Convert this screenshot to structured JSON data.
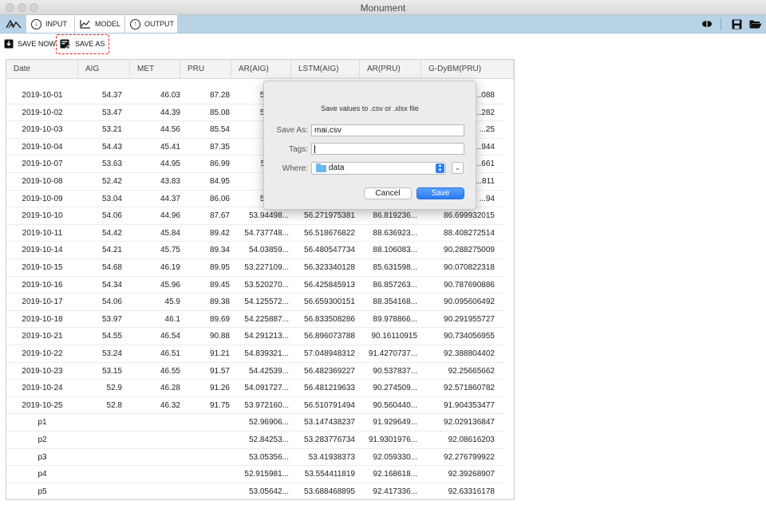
{
  "window": {
    "title": "Monument"
  },
  "tabs": [
    {
      "label": "INPUT",
      "icon": "arrow-down-circle-icon"
    },
    {
      "label": "MODEL",
      "icon": "chart-icon"
    },
    {
      "label": "OUTPUT",
      "icon": "arrow-up-circle-icon"
    }
  ],
  "toolbar": {
    "save_now_label": "SAVE NOW",
    "save_as_label": "SAVE AS"
  },
  "table": {
    "columns": [
      "Date",
      "AIG",
      "MET",
      "PRU",
      "AR(AIG)",
      "LSTM(AIG)",
      "AR(PRU)",
      "G-DyBM(PRU)"
    ],
    "rows": [
      [
        "2019-10-01",
        "54.37",
        "46.03",
        "87.28",
        "57.3886",
        "",
        "",
        "...088"
      ],
      [
        "2019-10-02",
        "53.47",
        "44.39",
        "85.08",
        "57.1207",
        "",
        "",
        "...282"
      ],
      [
        "2019-10-03",
        "53.21",
        "44.56",
        "85.54",
        "56.252",
        "",
        "",
        "...25"
      ],
      [
        "2019-10-04",
        "54.43",
        "45.41",
        "87.35",
        "56.605",
        "",
        "",
        "...944"
      ],
      [
        "2019-10-07",
        "53.63",
        "44.95",
        "86.99",
        "56.1166",
        "",
        "",
        "...661"
      ],
      [
        "2019-10-08",
        "52.42",
        "43.83",
        "84.95",
        "55.070",
        "",
        "",
        "...811"
      ],
      [
        "2019-10-09",
        "53.04",
        "44.37",
        "86.06",
        "54.2179",
        "",
        "",
        "...94"
      ],
      [
        "2019-10-10",
        "54.06",
        "44.96",
        "87.67",
        "53.94498...",
        "56.271975381",
        "86.819236...",
        "86.699932015"
      ],
      [
        "2019-10-11",
        "54.42",
        "45.84",
        "89.42",
        "54.737748...",
        "56.518676822",
        "88.636923...",
        "88.408272514"
      ],
      [
        "2019-10-14",
        "54.21",
        "45.75",
        "89.34",
        "54.03859...",
        "56.480547734",
        "88.106083...",
        "90.288275009"
      ],
      [
        "2019-10-15",
        "54.68",
        "46.19",
        "89.95",
        "53.227109...",
        "56.323340128",
        "85.631598...",
        "90.070822318"
      ],
      [
        "2019-10-16",
        "54.34",
        "45.96",
        "89.45",
        "53.520270...",
        "56.425845913",
        "86.857263...",
        "90.787690886"
      ],
      [
        "2019-10-17",
        "54.06",
        "45.9",
        "89.38",
        "54.125572...",
        "56.659300151",
        "88.354168...",
        "90.095606492"
      ],
      [
        "2019-10-18",
        "53.97",
        "46.1",
        "89.69",
        "54.225887...",
        "56.833508286",
        "89.978866...",
        "90.291955727"
      ],
      [
        "2019-10-21",
        "54.55",
        "46.54",
        "90.88",
        "54.291213...",
        "56.896073788",
        "90.16110915",
        "90.734056955"
      ],
      [
        "2019-10-22",
        "53.24",
        "46.51",
        "91.21",
        "54.839321...",
        "57.048948312",
        "91.4270737...",
        "92.388804402"
      ],
      [
        "2019-10-23",
        "53.15",
        "46.55",
        "91.57",
        "54.42539...",
        "56.482369227",
        "90.537837...",
        "92.25665662"
      ],
      [
        "2019-10-24",
        "52.9",
        "46.28",
        "91.26",
        "54.091727...",
        "56.481219633",
        "90.274509...",
        "92.571860782"
      ],
      [
        "2019-10-25",
        "52.8",
        "46.32",
        "91.75",
        "53.972160...",
        "56.510791494",
        "90.560440...",
        "91.904353477"
      ],
      [
        "p1",
        "",
        "",
        "",
        "52.96906...",
        "53.147438237",
        "91.929649...",
        "92.029136847"
      ],
      [
        "p2",
        "",
        "",
        "",
        "52.84253...",
        "53.283776734",
        "91.9301976...",
        "92.08616203"
      ],
      [
        "p3",
        "",
        "",
        "",
        "53.05356...",
        "53.41938373",
        "92.059330...",
        "92.276799922"
      ],
      [
        "p4",
        "",
        "",
        "",
        "52.915981...",
        "53.554411819",
        "92.168618...",
        "92.39268907"
      ],
      [
        "p5",
        "",
        "",
        "",
        "53.05642...",
        "53.688468895",
        "92.417336...",
        "92.63316178"
      ]
    ]
  },
  "dialog": {
    "message": "Save values to .csv or .xlsx file",
    "save_as_label": "Save As:",
    "save_as_value": "mai.csv",
    "tags_label": "Tags:",
    "tags_value": "",
    "where_label": "Where:",
    "where_value": "data",
    "cancel_label": "Cancel",
    "save_label": "Save"
  },
  "colors": {
    "tabbar": "#b8d3e6",
    "highlight": "#e0231a",
    "save_button": "#2b79f3",
    "folder": "#6bb7ec"
  }
}
